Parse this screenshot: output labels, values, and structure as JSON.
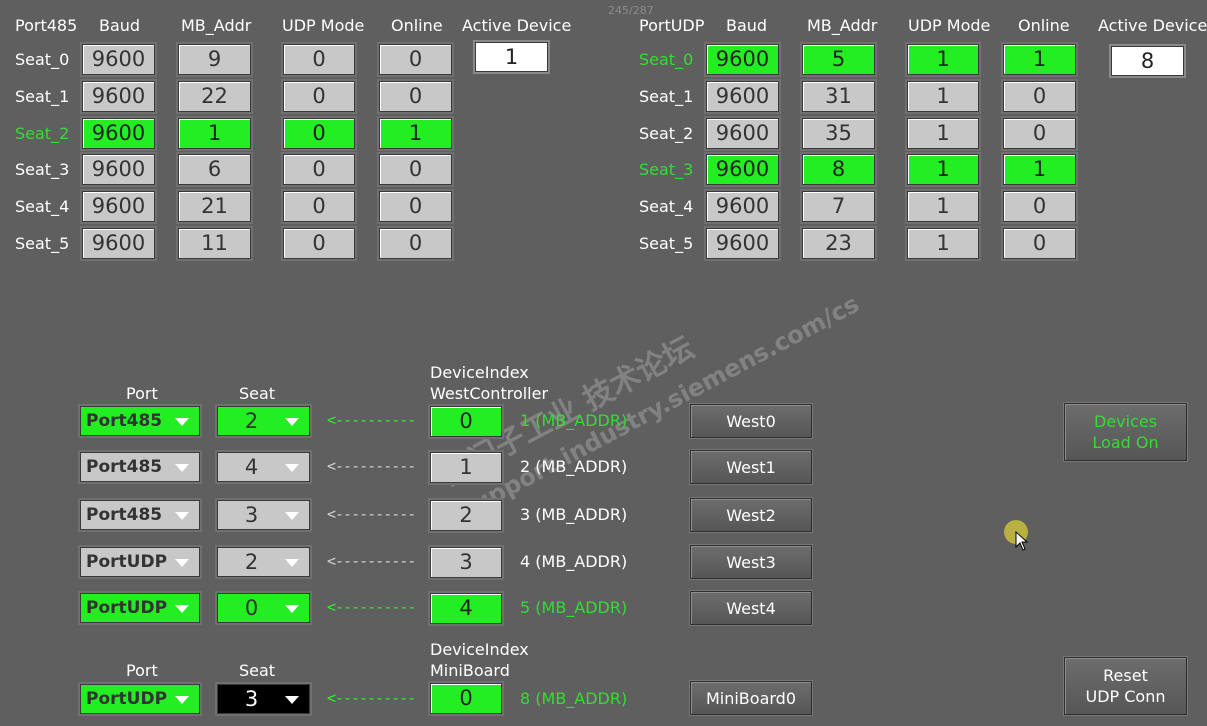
{
  "page_counter": "245/287",
  "watermark": {
    "line1": "西门子工业 技术论坛",
    "line2": "support.industry.siemens.com/cs"
  },
  "port485": {
    "headers": [
      "Port485",
      "Baud",
      "MB_Addr",
      "UDP Mode",
      "Online"
    ],
    "active_label": "Active Device",
    "active_value": "1",
    "rows": [
      {
        "seat": "Seat_0",
        "baud": "9600",
        "addr": "9",
        "udp": "0",
        "online": "0",
        "on": false
      },
      {
        "seat": "Seat_1",
        "baud": "9600",
        "addr": "22",
        "udp": "0",
        "online": "0",
        "on": false
      },
      {
        "seat": "Seat_2",
        "baud": "9600",
        "addr": "1",
        "udp": "0",
        "online": "1",
        "on": true
      },
      {
        "seat": "Seat_3",
        "baud": "9600",
        "addr": "6",
        "udp": "0",
        "online": "0",
        "on": false
      },
      {
        "seat": "Seat_4",
        "baud": "9600",
        "addr": "21",
        "udp": "0",
        "online": "0",
        "on": false
      },
      {
        "seat": "Seat_5",
        "baud": "9600",
        "addr": "11",
        "udp": "0",
        "online": "0",
        "on": false
      }
    ]
  },
  "portudp": {
    "headers": [
      "PortUDP",
      "Baud",
      "MB_Addr",
      "UDP Mode",
      "Online"
    ],
    "active_label": "Active Device",
    "active_value": "8",
    "rows": [
      {
        "seat": "Seat_0",
        "baud": "9600",
        "addr": "5",
        "udp": "1",
        "online": "1",
        "on": true
      },
      {
        "seat": "Seat_1",
        "baud": "9600",
        "addr": "31",
        "udp": "1",
        "online": "0",
        "on": false
      },
      {
        "seat": "Seat_2",
        "baud": "9600",
        "addr": "35",
        "udp": "1",
        "online": "0",
        "on": false
      },
      {
        "seat": "Seat_3",
        "baud": "9600",
        "addr": "8",
        "udp": "1",
        "online": "1",
        "on": true
      },
      {
        "seat": "Seat_4",
        "baud": "9600",
        "addr": "7",
        "udp": "1",
        "online": "0",
        "on": false
      },
      {
        "seat": "Seat_5",
        "baud": "9600",
        "addr": "23",
        "udp": "1",
        "online": "0",
        "on": false
      }
    ]
  },
  "west": {
    "port_header": "Port",
    "seat_header": "Seat",
    "device_index_header": "DeviceIndex",
    "controller_header": "WestController",
    "arrow_text": "<----------",
    "rows": [
      {
        "port": "Port485",
        "seat": "2",
        "index": "0",
        "mb": "1 (MB_ADDR)",
        "button": "West0",
        "on": true
      },
      {
        "port": "Port485",
        "seat": "4",
        "index": "1",
        "mb": "2 (MB_ADDR)",
        "button": "West1",
        "on": false
      },
      {
        "port": "Port485",
        "seat": "3",
        "index": "2",
        "mb": "3 (MB_ADDR)",
        "button": "West2",
        "on": false
      },
      {
        "port": "PortUDP",
        "seat": "2",
        "index": "3",
        "mb": "4 (MB_ADDR)",
        "button": "West3",
        "on": false
      },
      {
        "port": "PortUDP",
        "seat": "0",
        "index": "4",
        "mb": "5 (MB_ADDR)",
        "button": "West4",
        "on": true
      }
    ]
  },
  "mini": {
    "port_header": "Port",
    "seat_header": "Seat",
    "device_index_header": "DeviceIndex",
    "board_header": "MiniBoard",
    "arrow_text": "<----------",
    "port": "PortUDP",
    "seat": "3",
    "index": "0",
    "mb": "8 (MB_ADDR)",
    "button": "MiniBoard0"
  },
  "buttons": {
    "devices_load_line1": "Devices",
    "devices_load_line2": "Load On",
    "reset_line1": "Reset",
    "reset_line2": "UDP Conn"
  },
  "colors": {
    "background": "#5f5f5f",
    "online_green": "#22ee22",
    "label_green": "#33dd33",
    "cell_gray": "#c8c8c8"
  }
}
